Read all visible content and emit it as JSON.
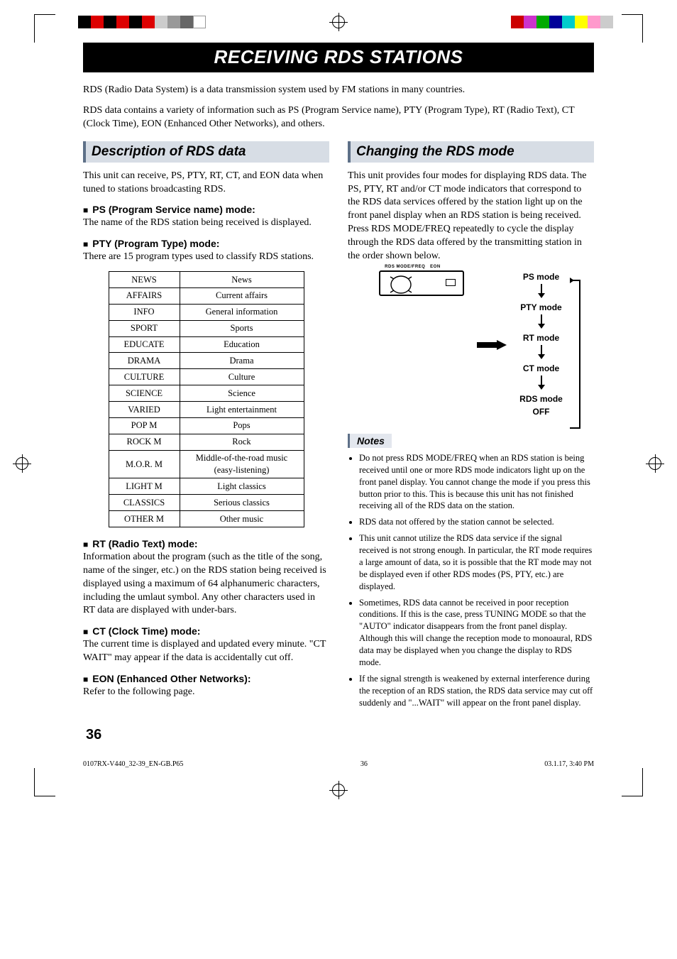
{
  "banner": "RECEIVING RDS STATIONS",
  "intro": {
    "p1": "RDS (Radio Data System) is a data transmission system used by FM stations in many countries.",
    "p2": "RDS data contains a variety of information such as PS (Program Service name), PTY (Program Type), RT (Radio Text), CT (Clock Time), EON (Enhanced Other Networks), and others."
  },
  "left": {
    "heading": "Description of RDS data",
    "lead": "This unit can receive, PS, PTY, RT, CT, and EON data when tuned to stations broadcasting RDS.",
    "ps": {
      "title": "PS (Program Service name) mode:",
      "desc": "The name of the RDS station being received is displayed."
    },
    "pty": {
      "title": "PTY (Program Type) mode:",
      "desc": "There are 15 program types used to classify RDS stations."
    },
    "rt": {
      "title": "RT (Radio Text) mode:",
      "desc": "Information about the program (such as the title of the song, name of the singer, etc.) on the RDS station being received is displayed using a maximum of 64 alphanumeric characters, including the umlaut symbol. Any other characters used in RT data are displayed with under-bars."
    },
    "ct": {
      "title": "CT (Clock Time) mode:",
      "desc": "The current time is displayed and updated every minute. \"CT WAIT\" may appear if the data is accidentally cut off."
    },
    "eon": {
      "title": "EON (Enhanced Other Networks):",
      "desc": "Refer to the following page."
    },
    "pty_rows": [
      {
        "code": "NEWS",
        "desc": "News"
      },
      {
        "code": "AFFAIRS",
        "desc": "Current affairs"
      },
      {
        "code": "INFO",
        "desc": "General information"
      },
      {
        "code": "SPORT",
        "desc": "Sports"
      },
      {
        "code": "EDUCATE",
        "desc": "Education"
      },
      {
        "code": "DRAMA",
        "desc": "Drama"
      },
      {
        "code": "CULTURE",
        "desc": "Culture"
      },
      {
        "code": "SCIENCE",
        "desc": "Science"
      },
      {
        "code": "VARIED",
        "desc": "Light entertainment"
      },
      {
        "code": "POP M",
        "desc": "Pops"
      },
      {
        "code": "ROCK M",
        "desc": "Rock"
      },
      {
        "code": "M.O.R. M",
        "desc": "Middle-of-the-road music (easy-listening)"
      },
      {
        "code": "LIGHT M",
        "desc": "Light classics"
      },
      {
        "code": "CLASSICS",
        "desc": "Serious classics"
      },
      {
        "code": "OTHER M",
        "desc": "Other music"
      }
    ]
  },
  "right": {
    "heading": "Changing the RDS mode",
    "lead": "This unit provides four modes for displaying RDS data. The PS, PTY, RT and/or CT mode indicators that correspond to the RDS data services offered by the station light up on the front panel display when an RDS station is being received. Press RDS MODE/FREQ repeatedly to cycle the display through the RDS data offered by the transmitting station in the order shown below.",
    "panel": {
      "label_left": "RDS MODE/FREQ",
      "label_right": "EON"
    },
    "steps": {
      "s1": "PS mode",
      "s2": "PTY mode",
      "s3": "RT mode",
      "s4": "CT mode",
      "s5a": "RDS mode",
      "s5b": "OFF"
    },
    "notes_head": "Notes",
    "notes": [
      "Do not press RDS MODE/FREQ when an RDS station is being received until one or more RDS mode indicators light up on the front panel display. You cannot change the mode if you press this button prior to this. This is because this unit has not finished receiving all of the RDS data on the station.",
      "RDS data not offered by the station cannot be selected.",
      "This unit cannot utilize the RDS data service if the signal received is not strong enough. In particular, the RT mode requires a large amount of data, so it is possible that the RT mode may not be displayed even if other RDS modes (PS, PTY, etc.) are displayed.",
      "Sometimes, RDS data cannot be received in poor reception conditions. If this is the case, press TUNING MODE so that the \"AUTO\" indicator disappears from the front panel display. Although this will change the reception mode to monoaural, RDS data may be displayed when you change the display to RDS mode.",
      "If the signal strength is weakened by external interference during the reception of an RDS station, the RDS data service may cut off suddenly and \"...WAIT\" will appear on the front panel display."
    ]
  },
  "page_num": "36",
  "footer": {
    "left": "0107RX-V440_32-39_EN-GB.P65",
    "mid": "36",
    "right": "03.1.17, 3:40 PM"
  }
}
